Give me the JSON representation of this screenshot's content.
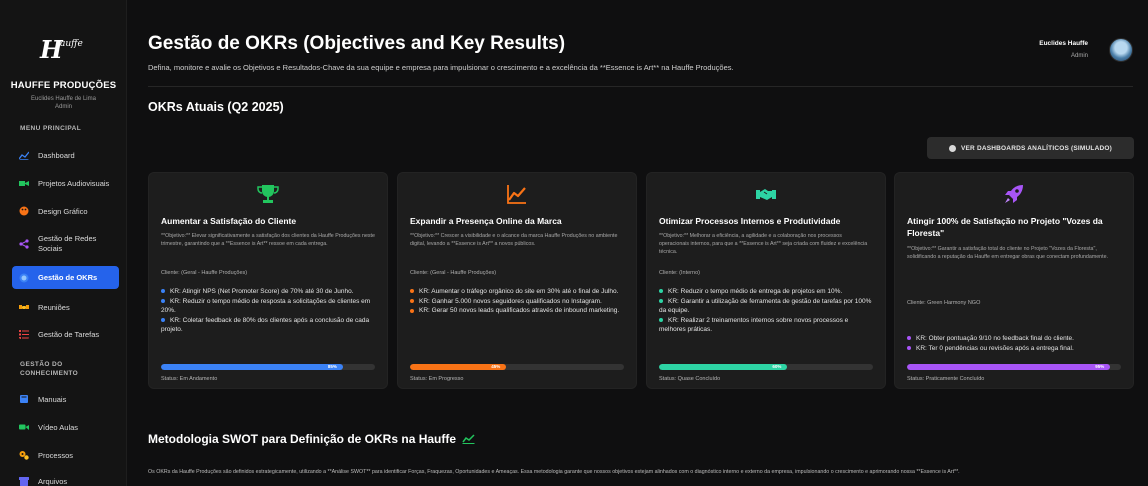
{
  "sidebar": {
    "brand": "HAUFFE PRODUÇÕES",
    "user_name": "Euclides Hauffe de Lima",
    "user_role": "Admin",
    "menu_title": "MENU PRINCIPAL",
    "items": [
      {
        "label": "Dashboard",
        "icon": "chart-line-icon",
        "color": "#3b82f6"
      },
      {
        "label": "Projetos Audiovisuais",
        "icon": "video-camera-icon",
        "color": "#22c55e"
      },
      {
        "label": "Design Gráfico",
        "icon": "palette-icon",
        "color": "#f97316"
      },
      {
        "label": "Gestão de Redes Sociais",
        "icon": "share-icon",
        "color": "#a855f7"
      },
      {
        "label": "Gestão de OKRs",
        "icon": "target-icon",
        "color": "#ffffff"
      },
      {
        "label": "Reuniões",
        "icon": "handshake-icon",
        "color": "#f59e0b"
      },
      {
        "label": "Gestão de Tarefas",
        "icon": "tasks-icon",
        "color": "#ef4444"
      }
    ],
    "knowledge_title": "GESTÃO DO CONHECIMENTO",
    "knowledge_items": [
      {
        "label": "Manuais",
        "icon": "book-icon",
        "color": "#3b82f6"
      },
      {
        "label": "Vídeo Aulas",
        "icon": "video-icon",
        "color": "#22c55e"
      },
      {
        "label": "Processos",
        "icon": "cogs-icon",
        "color": "#f59e0b"
      },
      {
        "label": "Arquivos",
        "icon": "archive-icon",
        "color": "#6366f1"
      }
    ]
  },
  "header": {
    "title": "Gestão de OKRs (Objectives and Key Results)",
    "subtitle": "Defina, monitore e avalie os Objetivos e Resultados-Chave da sua equipe e empresa para impulsionar o crescimento e a excelência da **Essence is Art** na Hauffe Produções.",
    "profile_name": "Euclides Hauffe",
    "profile_role": "Admin"
  },
  "okrs": {
    "section_title": "OKRs Atuais (Q2 2025)",
    "dashboard_button": "VER DASHBOARDS ANALÍTICOS (SIMULADO)",
    "cards": [
      {
        "icon": "trophy-icon",
        "color": "#22c55e",
        "title": "Aumentar a Satisfação do Cliente",
        "description": "**Objetivo:** Elevar significativamente a satisfação dos clientes da Hauffe Produções neste trimestre, garantindo que a **Essence is Art** ressoe em cada entrega.",
        "client": "Cliente: (Geral - Hauffe Produções)",
        "krs": [
          "KR: Atingir NPS (Net Promoter Score) de 70% até 30 de Junho.",
          "KR: Reduzir o tempo médio de resposta a solicitações de clientes em 20%.",
          "KR: Coletar feedback de 80% dos clientes após a conclusão de cada projeto."
        ],
        "progress": 85,
        "progress_label": "85%",
        "status": "Status: Em Andamento"
      },
      {
        "icon": "chart-line-icon",
        "color": "#f97316",
        "title": "Expandir a Presença Online da Marca",
        "description": "**Objetivo:** Crescer a visibilidade e o alcance da marca Hauffe Produções no ambiente digital, levando a **Essence is Art** a novos públicos.",
        "client": "Cliente: (Geral - Hauffe Produções)",
        "krs": [
          "KR: Aumentar o tráfego orgânico do site em 30% até o final de Julho.",
          "KR: Ganhar 5.000 novos seguidores qualificados no Instagram.",
          "KR: Gerar 50 novos leads qualificados através de inbound marketing."
        ],
        "progress": 45,
        "progress_label": "45%",
        "status": "Status: Em Progresso"
      },
      {
        "icon": "handshake-icon",
        "color": "#2dd4a4",
        "title": "Otimizar Processos Internos e Produtividade",
        "description": "**Objetivo:** Melhorar a eficiência, a agilidade e a colaboração nos processos operacionais internos, para que a **Essence is Art** seja criada com fluidez e excelência técnica.",
        "client": "Cliente: (Interno)",
        "krs": [
          "KR: Reduzir o tempo médio de entrega de projetos em 10%.",
          "KR: Garantir a utilização de ferramenta de gestão de tarefas por 100% da equipe.",
          "KR: Realizar 2 treinamentos internos sobre novos processos e melhores práticas."
        ],
        "progress": 60,
        "progress_label": "60%",
        "status": "Status: Quase Concluído"
      },
      {
        "icon": "rocket-icon",
        "color": "#a855f7",
        "title": "Atingir 100% de Satisfação no Projeto \"Vozes da Floresta\"",
        "description": "**Objetivo:** Garantir a satisfação total do cliente no Projeto \"Vozes da Floresta\", solidificando a reputação da Hauffe em entregar obras que conectam profundamente.",
        "client": "Cliente: Green Harmony NGO",
        "krs": [
          "KR: Obter pontuação 9/10 no feedback final do cliente.",
          "KR: Ter 0 pendências ou revisões após a entrega final."
        ],
        "progress": 95,
        "progress_label": "95%",
        "status": "Status: Praticamente Concluído"
      }
    ]
  },
  "swot": {
    "title": "Metodologia SWOT para Definição de OKRs na Hauffe",
    "text": "Os OKRs da Hauffe Produções são definidos estrategicamente, utilizando a **Análise SWOT** para identificar Forças, Fraquezas, Oportunidades e Ameaças. Essa metodologia garante que nossos objetivos estejam alinhados com o diagnóstico interno e externo da empresa, impulsionando o crescimento e aprimorando nossa **Essence is Art**."
  }
}
